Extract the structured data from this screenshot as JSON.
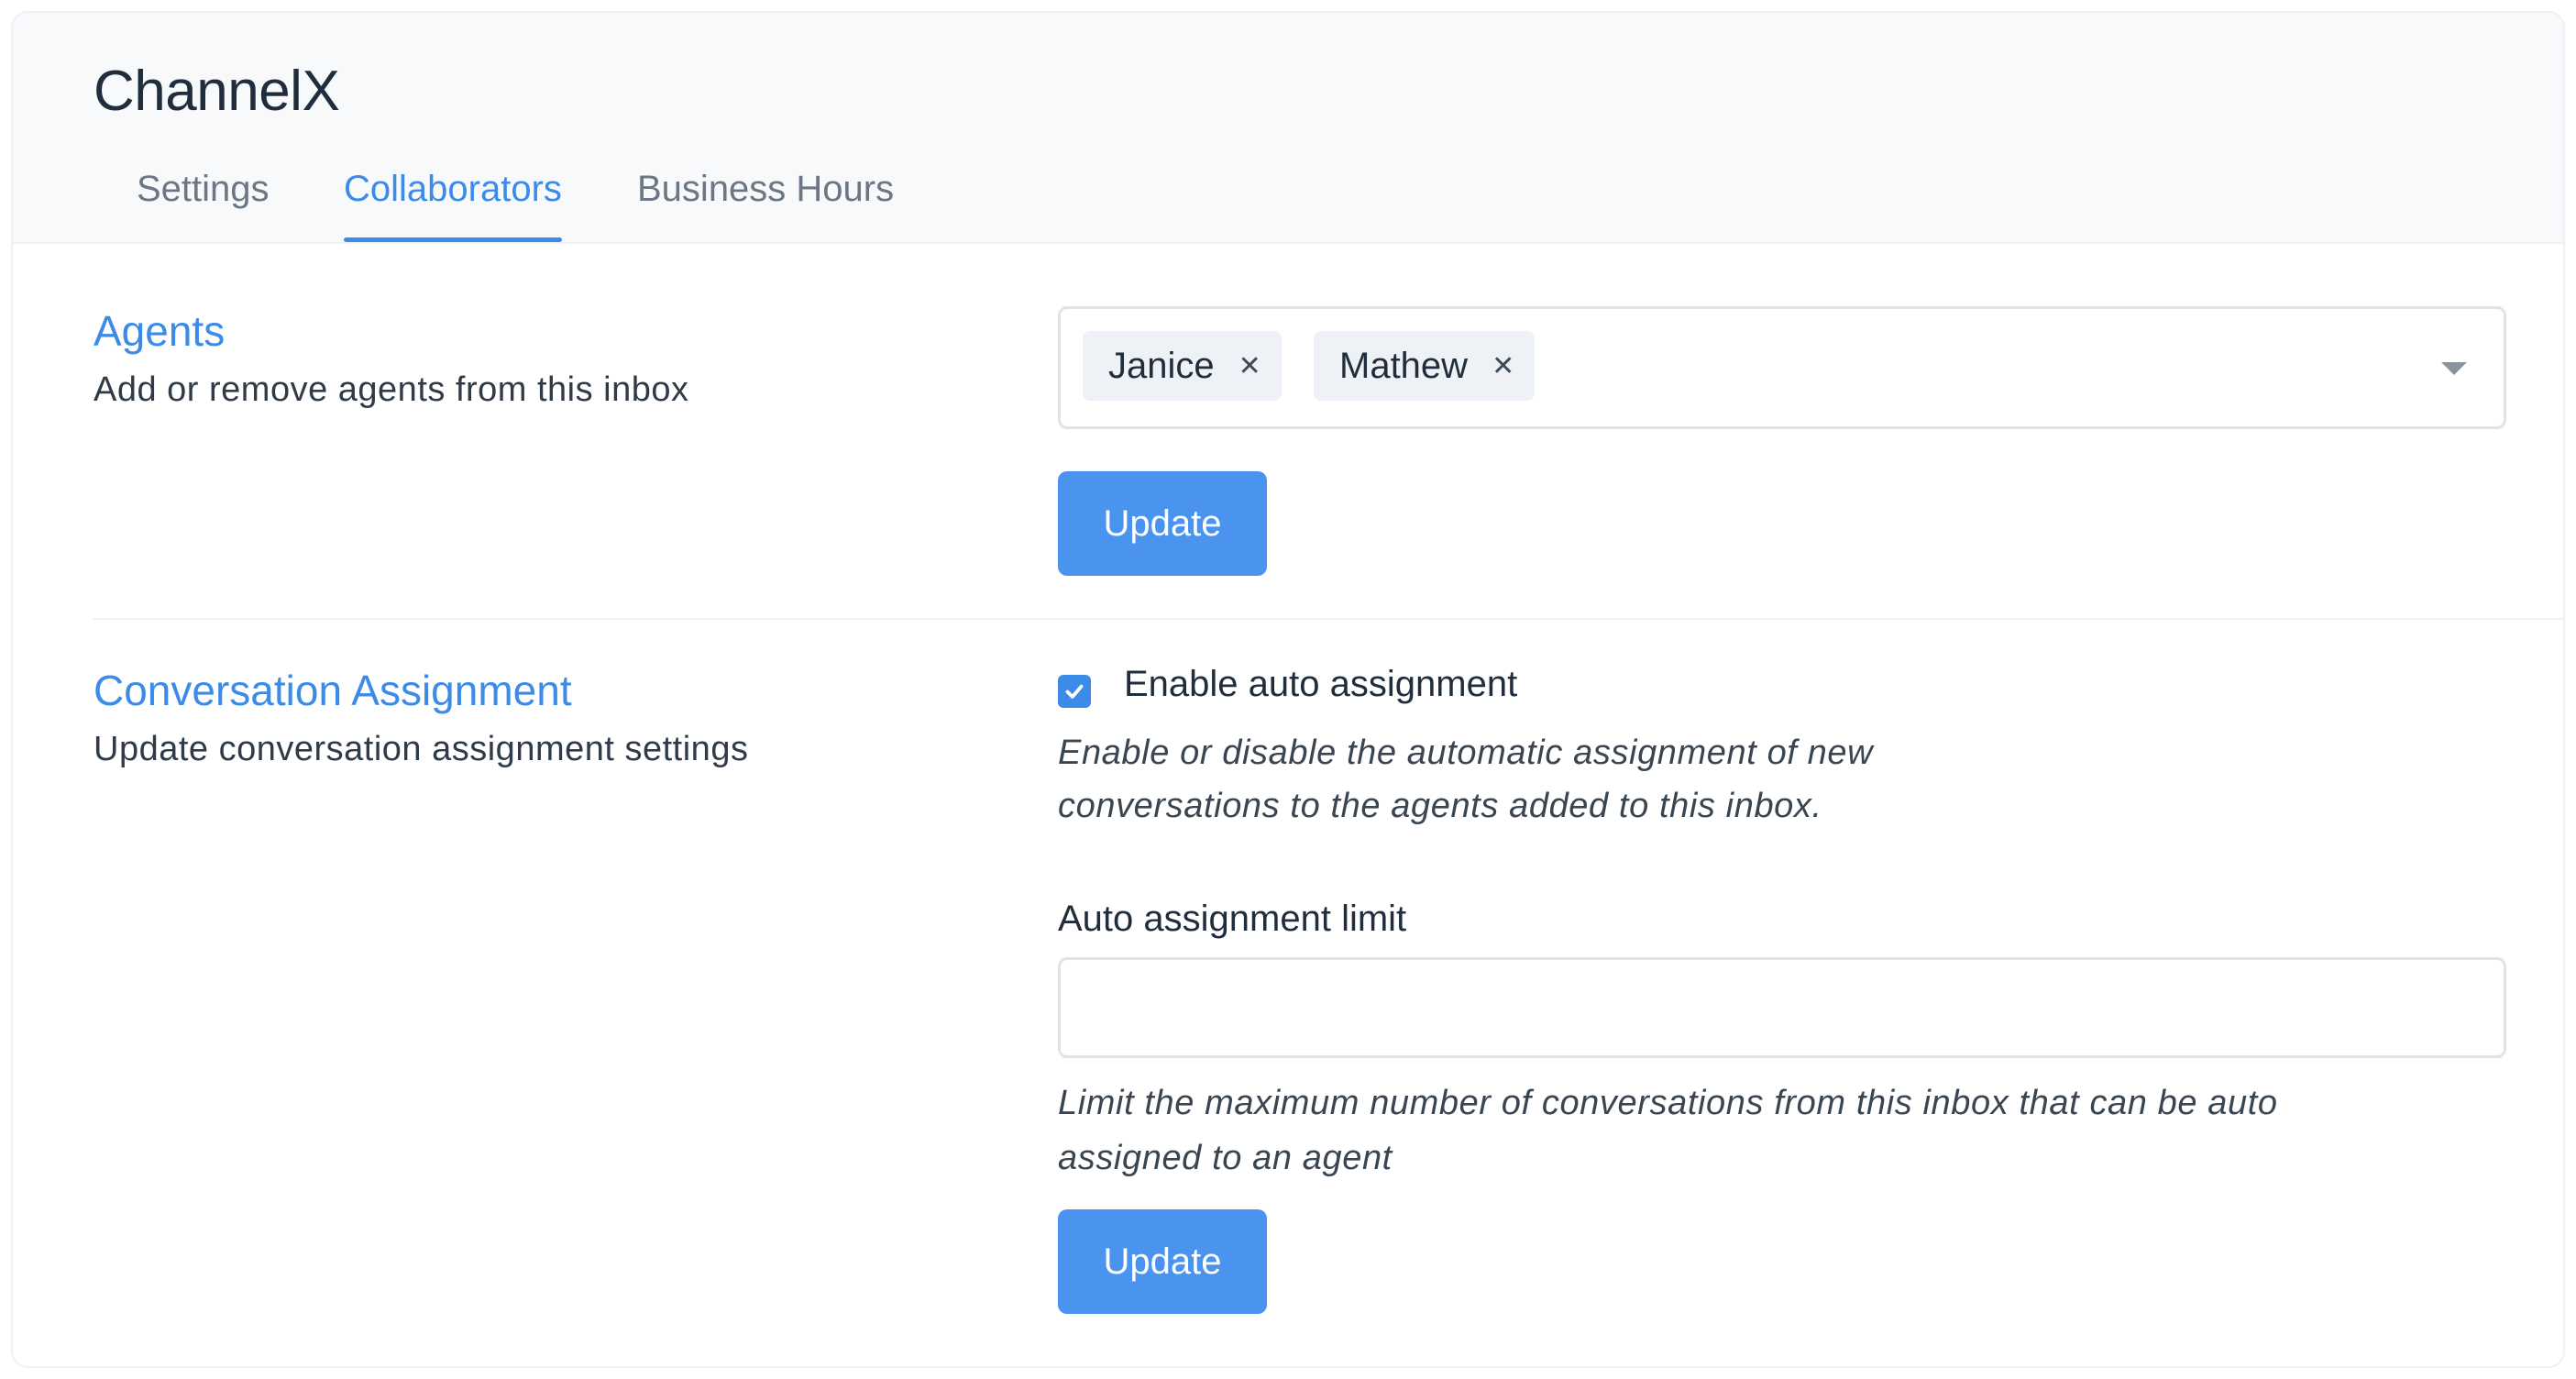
{
  "header": {
    "title": "ChannelX",
    "tabs": [
      {
        "label": "Settings",
        "active": false
      },
      {
        "label": "Collaborators",
        "active": true
      },
      {
        "label": "Business Hours",
        "active": false
      }
    ]
  },
  "agents": {
    "title": "Agents",
    "description": "Add or remove agents from this inbox",
    "selected": [
      {
        "label": "Janice",
        "remove_icon": "close-icon"
      },
      {
        "label": "Mathew",
        "remove_icon": "close-icon"
      }
    ],
    "dropdown_icon": "caret-down-icon",
    "update_label": "Update"
  },
  "assignment": {
    "title": "Conversation Assignment",
    "description": "Update conversation assignment settings",
    "auto_assign_checked": true,
    "auto_assign_label": "Enable auto assignment",
    "auto_assign_help_line1": "Enable or disable the automatic assignment of new",
    "auto_assign_help_line2": "conversations to the agents added to this inbox.",
    "limit_label": "Auto assignment limit",
    "limit_value": "",
    "limit_help_line1": "Limit the maximum number of conversations from this inbox that can be auto",
    "limit_help_line2": "assigned to an agent",
    "update_label": "Update"
  },
  "colors": {
    "accent": "#3c8be8",
    "button": "#4a94f0",
    "text": "#1f2d3d",
    "muted": "#6b7785"
  }
}
